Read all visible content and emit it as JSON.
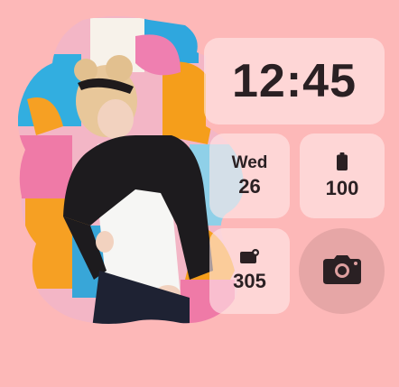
{
  "clock": {
    "time": "12:45"
  },
  "date": {
    "weekday": "Wed",
    "day": "26"
  },
  "battery": {
    "icon": "battery-icon",
    "value": "100"
  },
  "photos": {
    "icon": "photo-count-icon",
    "value": "305"
  },
  "camera": {
    "icon": "camera-icon"
  },
  "colors": {
    "background": "#fdb8b8",
    "tile": "#ffe9e9",
    "text": "#2a2023",
    "camera_button": "#dea0a0"
  }
}
